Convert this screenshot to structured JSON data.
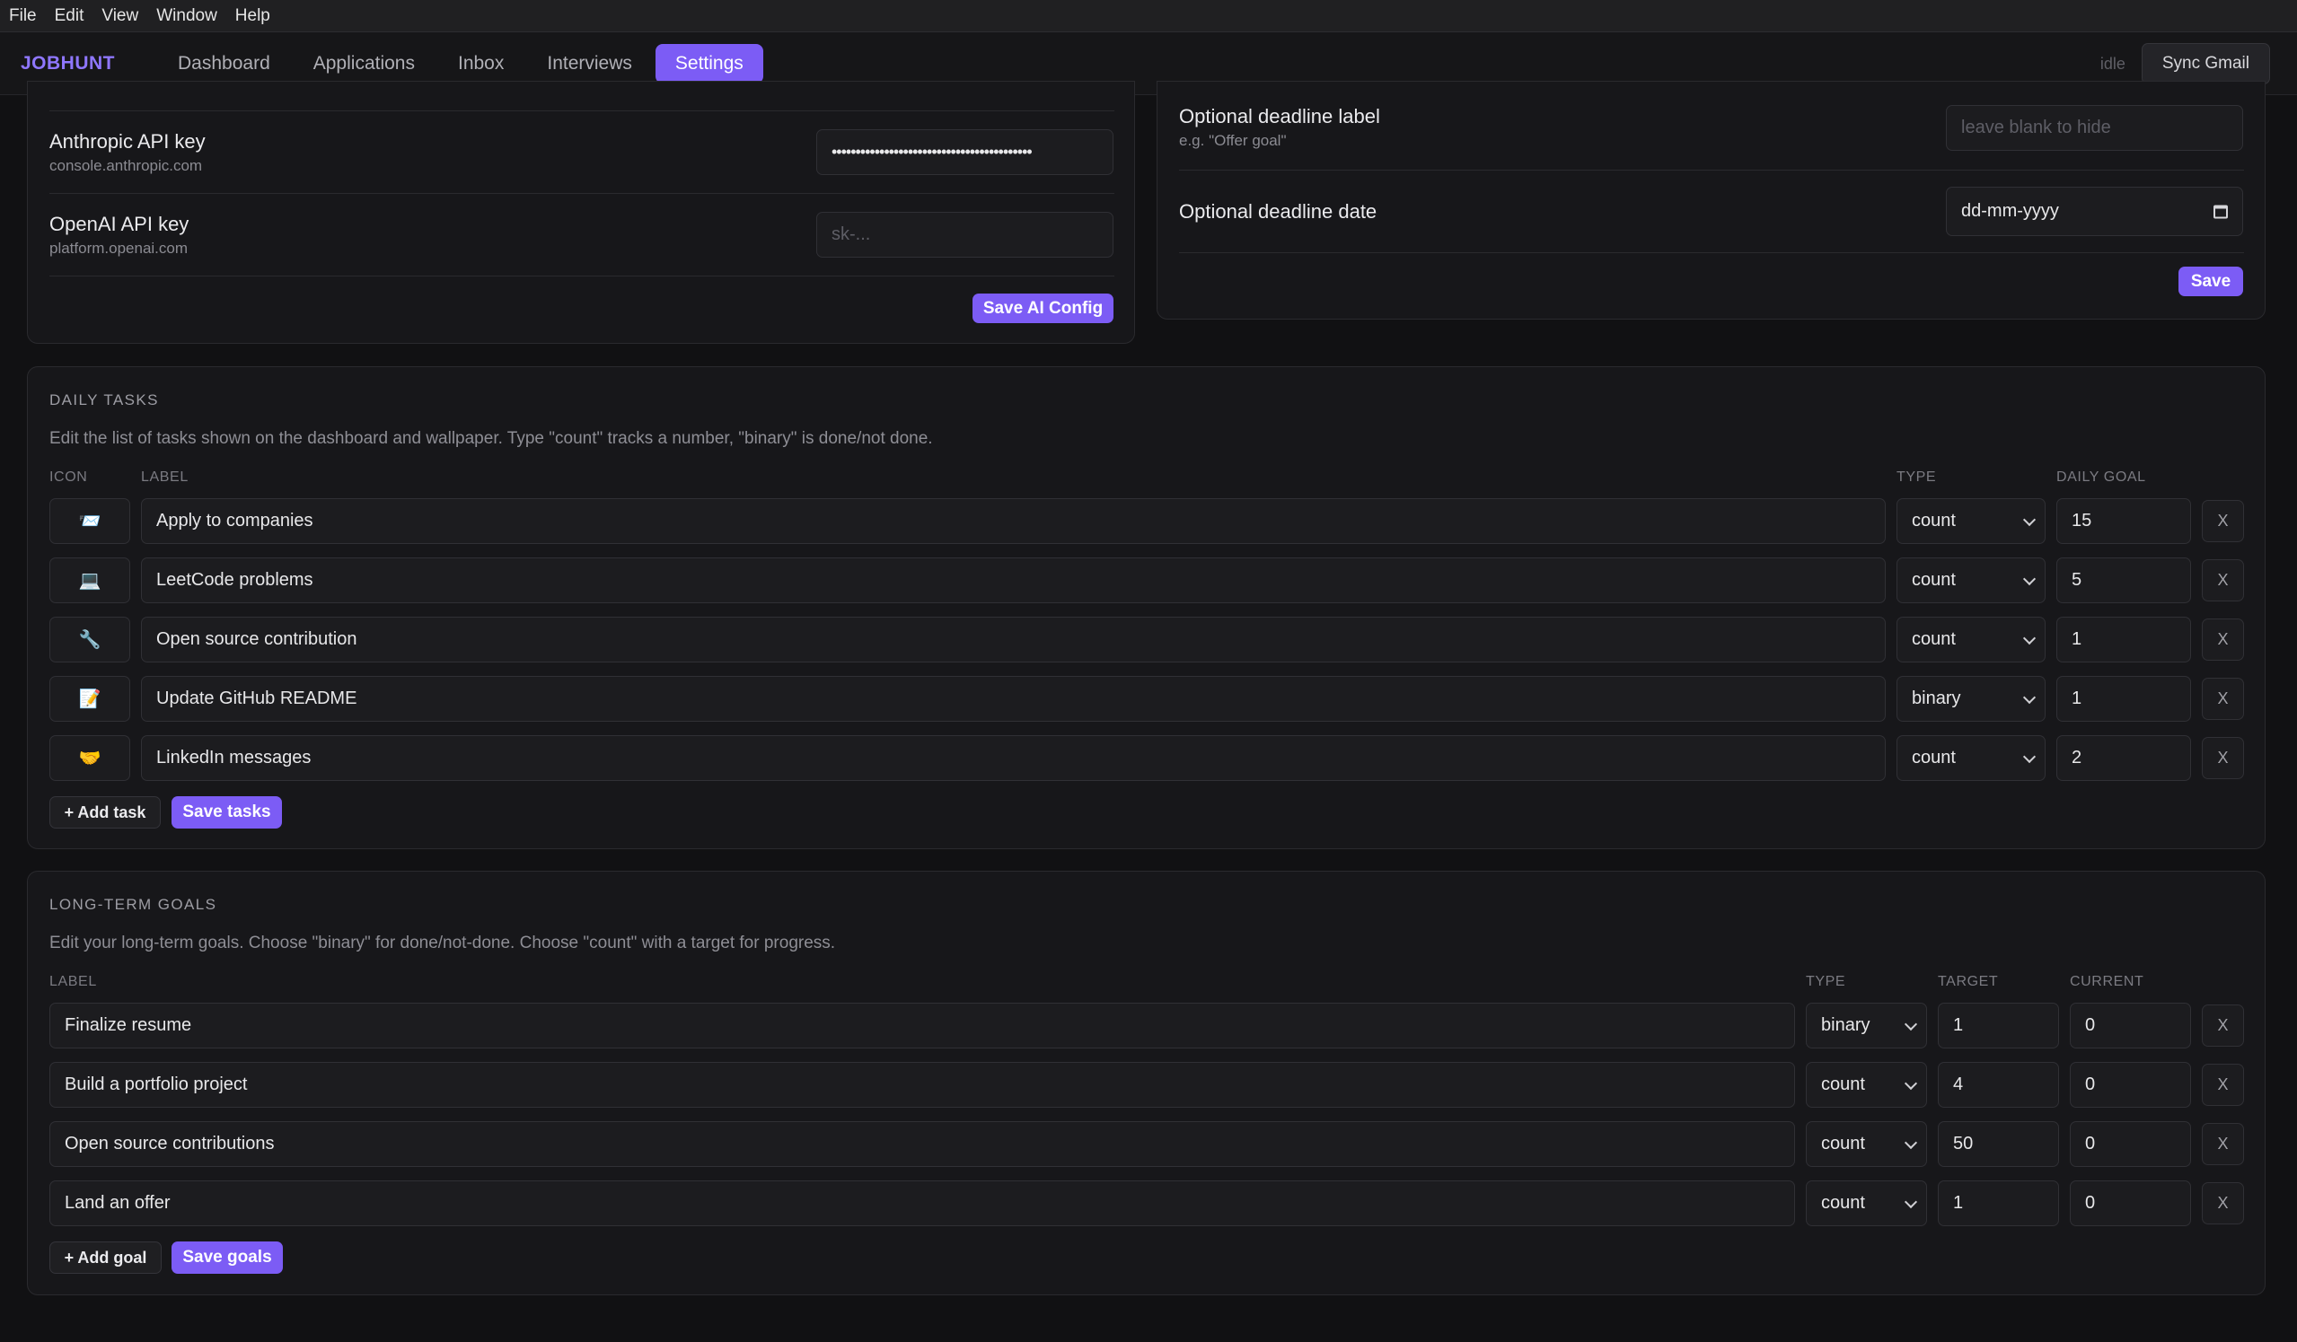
{
  "os_menu": [
    "File",
    "Edit",
    "View",
    "Window",
    "Help"
  ],
  "app": {
    "brand": "JOBHUNT",
    "tabs": [
      "Dashboard",
      "Applications",
      "Inbox",
      "Interviews",
      "Settings"
    ],
    "active_tab": "Settings",
    "status": "idle",
    "sync_label": "Sync Gmail"
  },
  "ai_config": {
    "anthropic": {
      "label": "Anthropic API key",
      "sub": "console.anthropic.com",
      "value": "••••••••••••••••••••••••••••••••••••••••••"
    },
    "openai": {
      "label": "OpenAI API key",
      "sub": "platform.openai.com",
      "placeholder": "sk-..."
    },
    "save_label": "Save AI Config"
  },
  "deadline": {
    "label_field": {
      "label": "Optional deadline label",
      "sub": "e.g. \"Offer goal\"",
      "placeholder": "leave blank to hide"
    },
    "date_field": {
      "label": "Optional deadline date",
      "placeholder": "dd-mm-yyyy"
    },
    "save_label": "Save"
  },
  "daily_tasks": {
    "title": "DAILY TASKS",
    "description": "Edit the list of tasks shown on the dashboard and wallpaper. Type \"count\" tracks a number, \"binary\" is done/not done.",
    "columns": {
      "icon": "ICON",
      "label": "LABEL",
      "type": "TYPE",
      "goal": "DAILY GOAL"
    },
    "rows": [
      {
        "icon": "📨",
        "label": "Apply to companies",
        "type": "count",
        "goal": "15"
      },
      {
        "icon": "💻",
        "label": "LeetCode problems",
        "type": "count",
        "goal": "5"
      },
      {
        "icon": "🔧",
        "label": "Open source contribution",
        "type": "count",
        "goal": "1"
      },
      {
        "icon": "📝",
        "label": "Update GitHub README",
        "type": "binary",
        "goal": "1"
      },
      {
        "icon": "🤝",
        "label": "LinkedIn messages",
        "type": "count",
        "goal": "2"
      }
    ],
    "remove_label": "X",
    "add_label": "+ Add task",
    "save_label": "Save tasks"
  },
  "long_term_goals": {
    "title": "LONG-TERM GOALS",
    "description": "Edit your long-term goals. Choose \"binary\" for done/not-done. Choose \"count\" with a target for progress.",
    "columns": {
      "label": "LABEL",
      "type": "TYPE",
      "target": "TARGET",
      "current": "CURRENT"
    },
    "rows": [
      {
        "label": "Finalize resume",
        "type": "binary",
        "target": "1",
        "current": "0"
      },
      {
        "label": "Build a portfolio project",
        "type": "count",
        "target": "4",
        "current": "0"
      },
      {
        "label": "Open source contributions",
        "type": "count",
        "target": "50",
        "current": "0"
      },
      {
        "label": "Land an offer",
        "type": "count",
        "target": "1",
        "current": "0"
      }
    ],
    "remove_label": "X",
    "add_label": "+ Add goal",
    "save_label": "Save goals"
  }
}
